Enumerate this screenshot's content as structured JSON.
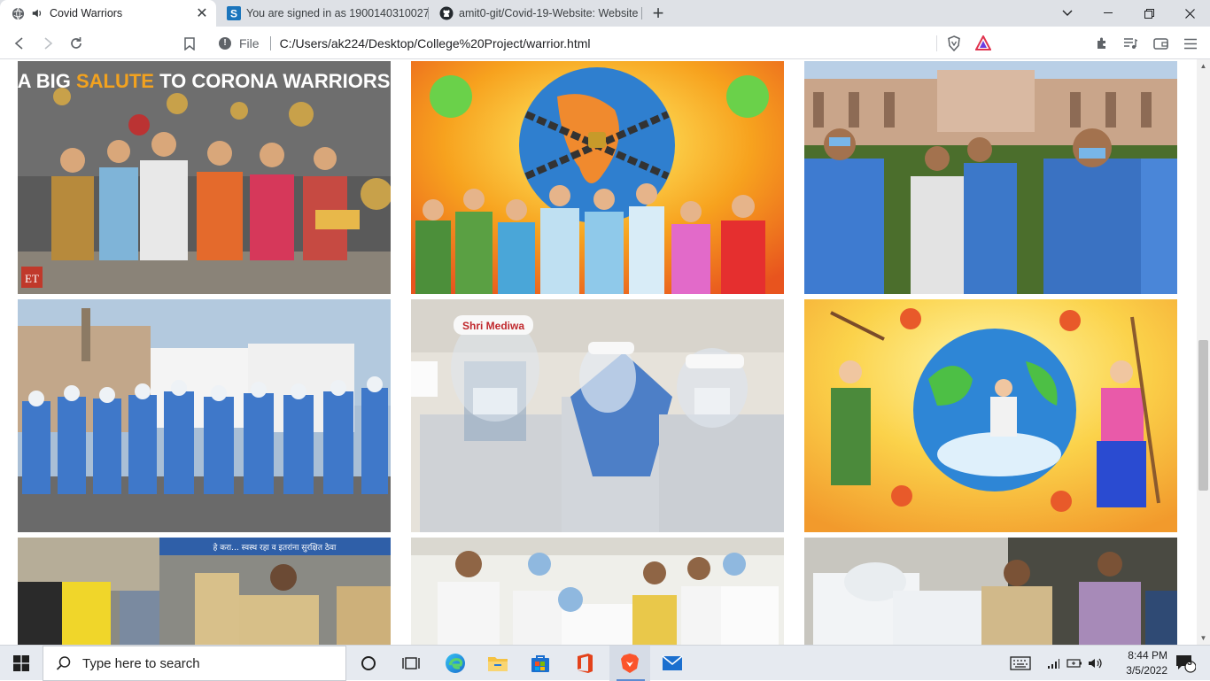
{
  "tabs": [
    {
      "title": "Covid Warriors",
      "active": true
    },
    {
      "title": "You are signed in as 1900140310027",
      "active": false
    },
    {
      "title": "amit0-git/Covid-19-Website: Website",
      "active": false
    }
  ],
  "toolbar": {
    "file_label": "File",
    "url": "C:/Users/ak224/Desktop/College%20Project/warrior.html"
  },
  "gallery": [
    {
      "caption": "A BIG SALUTE TO CORONA WARRIORS",
      "caption_highlight": "SALUTE",
      "badge": "ET",
      "kind": "mural"
    },
    {
      "kind": "painting-chain"
    },
    {
      "kind": "photo-nurses"
    },
    {
      "kind": "photo-ppe-group"
    },
    {
      "shield_text": "Shri Mediwa",
      "kind": "photo-shields"
    },
    {
      "kind": "painting-globe"
    },
    {
      "sign_text": "हे करा... स्वस्थ रहा व इतरांना सुरक्षित ठेवा",
      "kind": "photo-police"
    },
    {
      "kind": "photo-doctors"
    },
    {
      "kind": "photo-testing"
    }
  ],
  "taskbar": {
    "search_placeholder": "Type here to search",
    "time": "8:44 PM",
    "date": "3/5/2022",
    "notification_count": "3"
  },
  "colors": {
    "tab_strip": "#dee1e6",
    "taskbar": "#e6eaf0",
    "accent": "#5d8bd1"
  }
}
